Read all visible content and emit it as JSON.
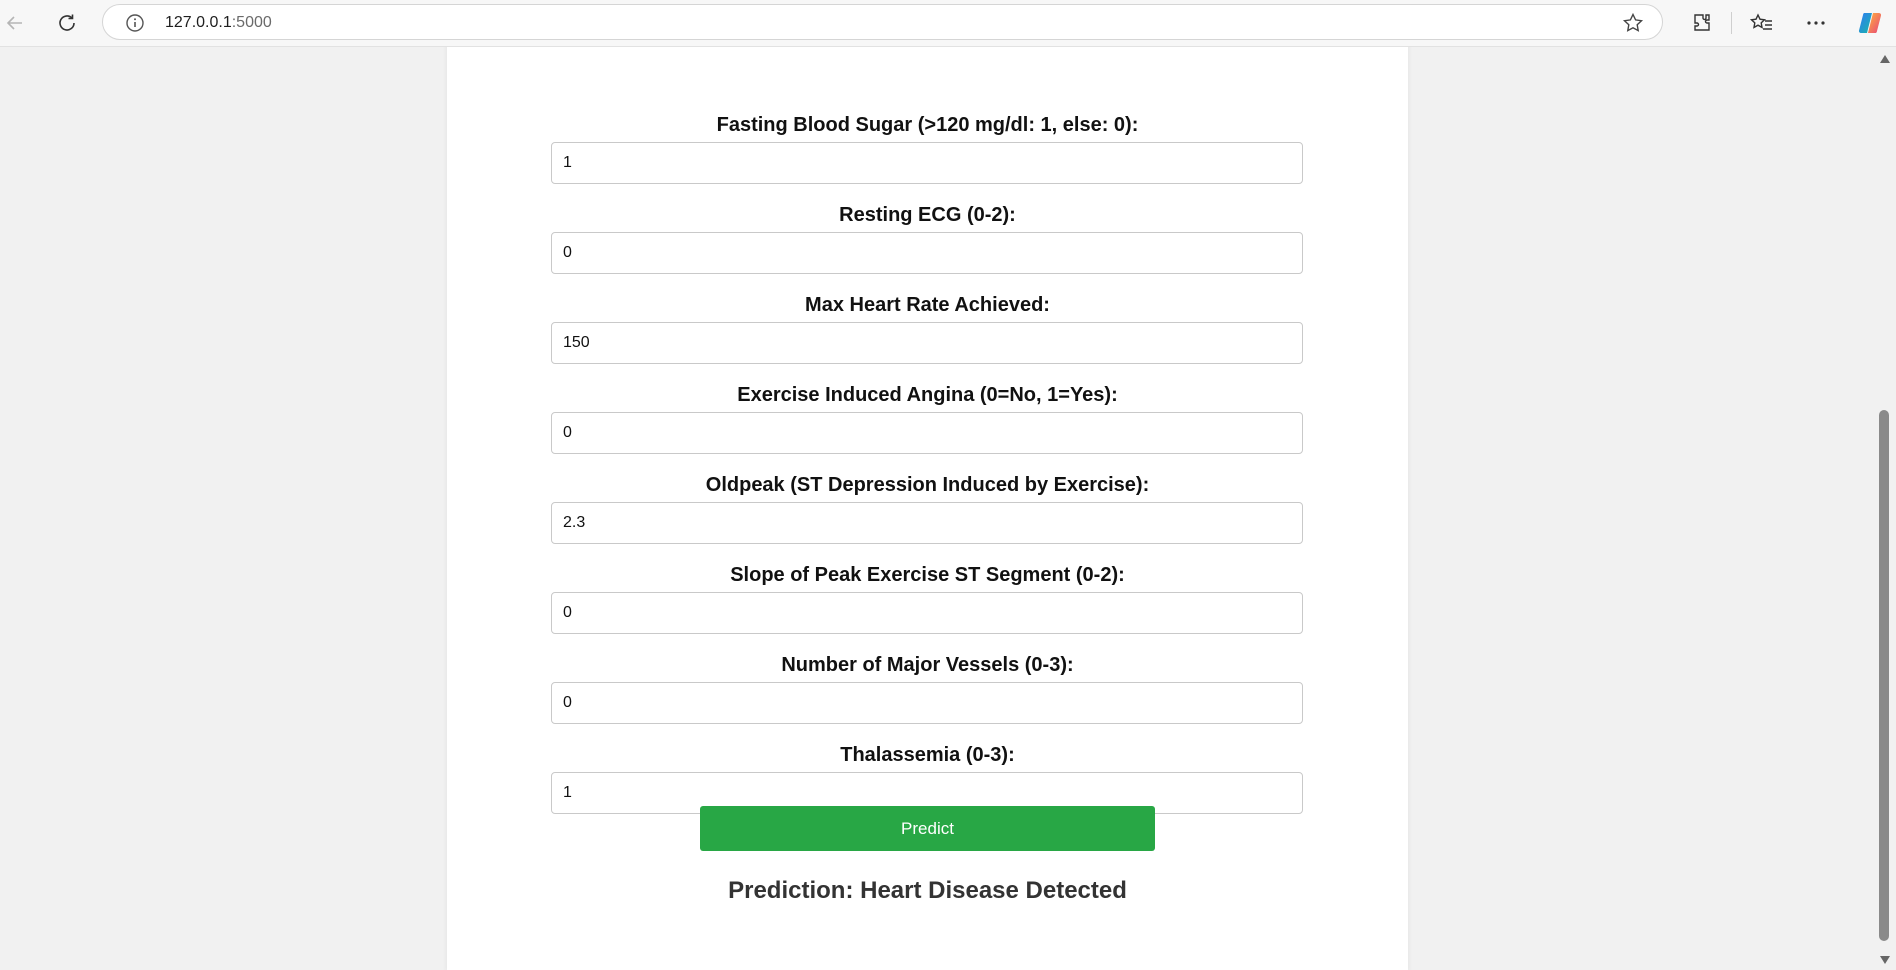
{
  "browser": {
    "url_host": "127.0.0.1",
    "url_port": ":5000",
    "icons": [
      "back-icon",
      "reload-icon",
      "site-info-icon",
      "favorite-star-icon",
      "extensions-icon",
      "favorites-icon",
      "more-icon",
      "copilot-icon"
    ]
  },
  "form": {
    "fields": [
      {
        "label": "Fasting Blood Sugar (>120 mg/dl: 1, else: 0):",
        "value": "1"
      },
      {
        "label": "Resting ECG (0-2):",
        "value": "0"
      },
      {
        "label": "Max Heart Rate Achieved:",
        "value": "150"
      },
      {
        "label": "Exercise Induced Angina (0=No, 1=Yes):",
        "value": "0"
      },
      {
        "label": "Oldpeak (ST Depression Induced by Exercise):",
        "value": "2.3"
      },
      {
        "label": "Slope of Peak Exercise ST Segment (0-2):",
        "value": "0"
      },
      {
        "label": "Number of Major Vessels (0-3):",
        "value": "0"
      },
      {
        "label": "Thalassemia (0-3):",
        "value": "1"
      }
    ],
    "predict_label": "Predict",
    "result_text": "Prediction: Heart Disease Detected"
  },
  "colors": {
    "predict_button": "#28a745",
    "page_background": "#f1f1f1",
    "card_background": "#ffffff"
  }
}
